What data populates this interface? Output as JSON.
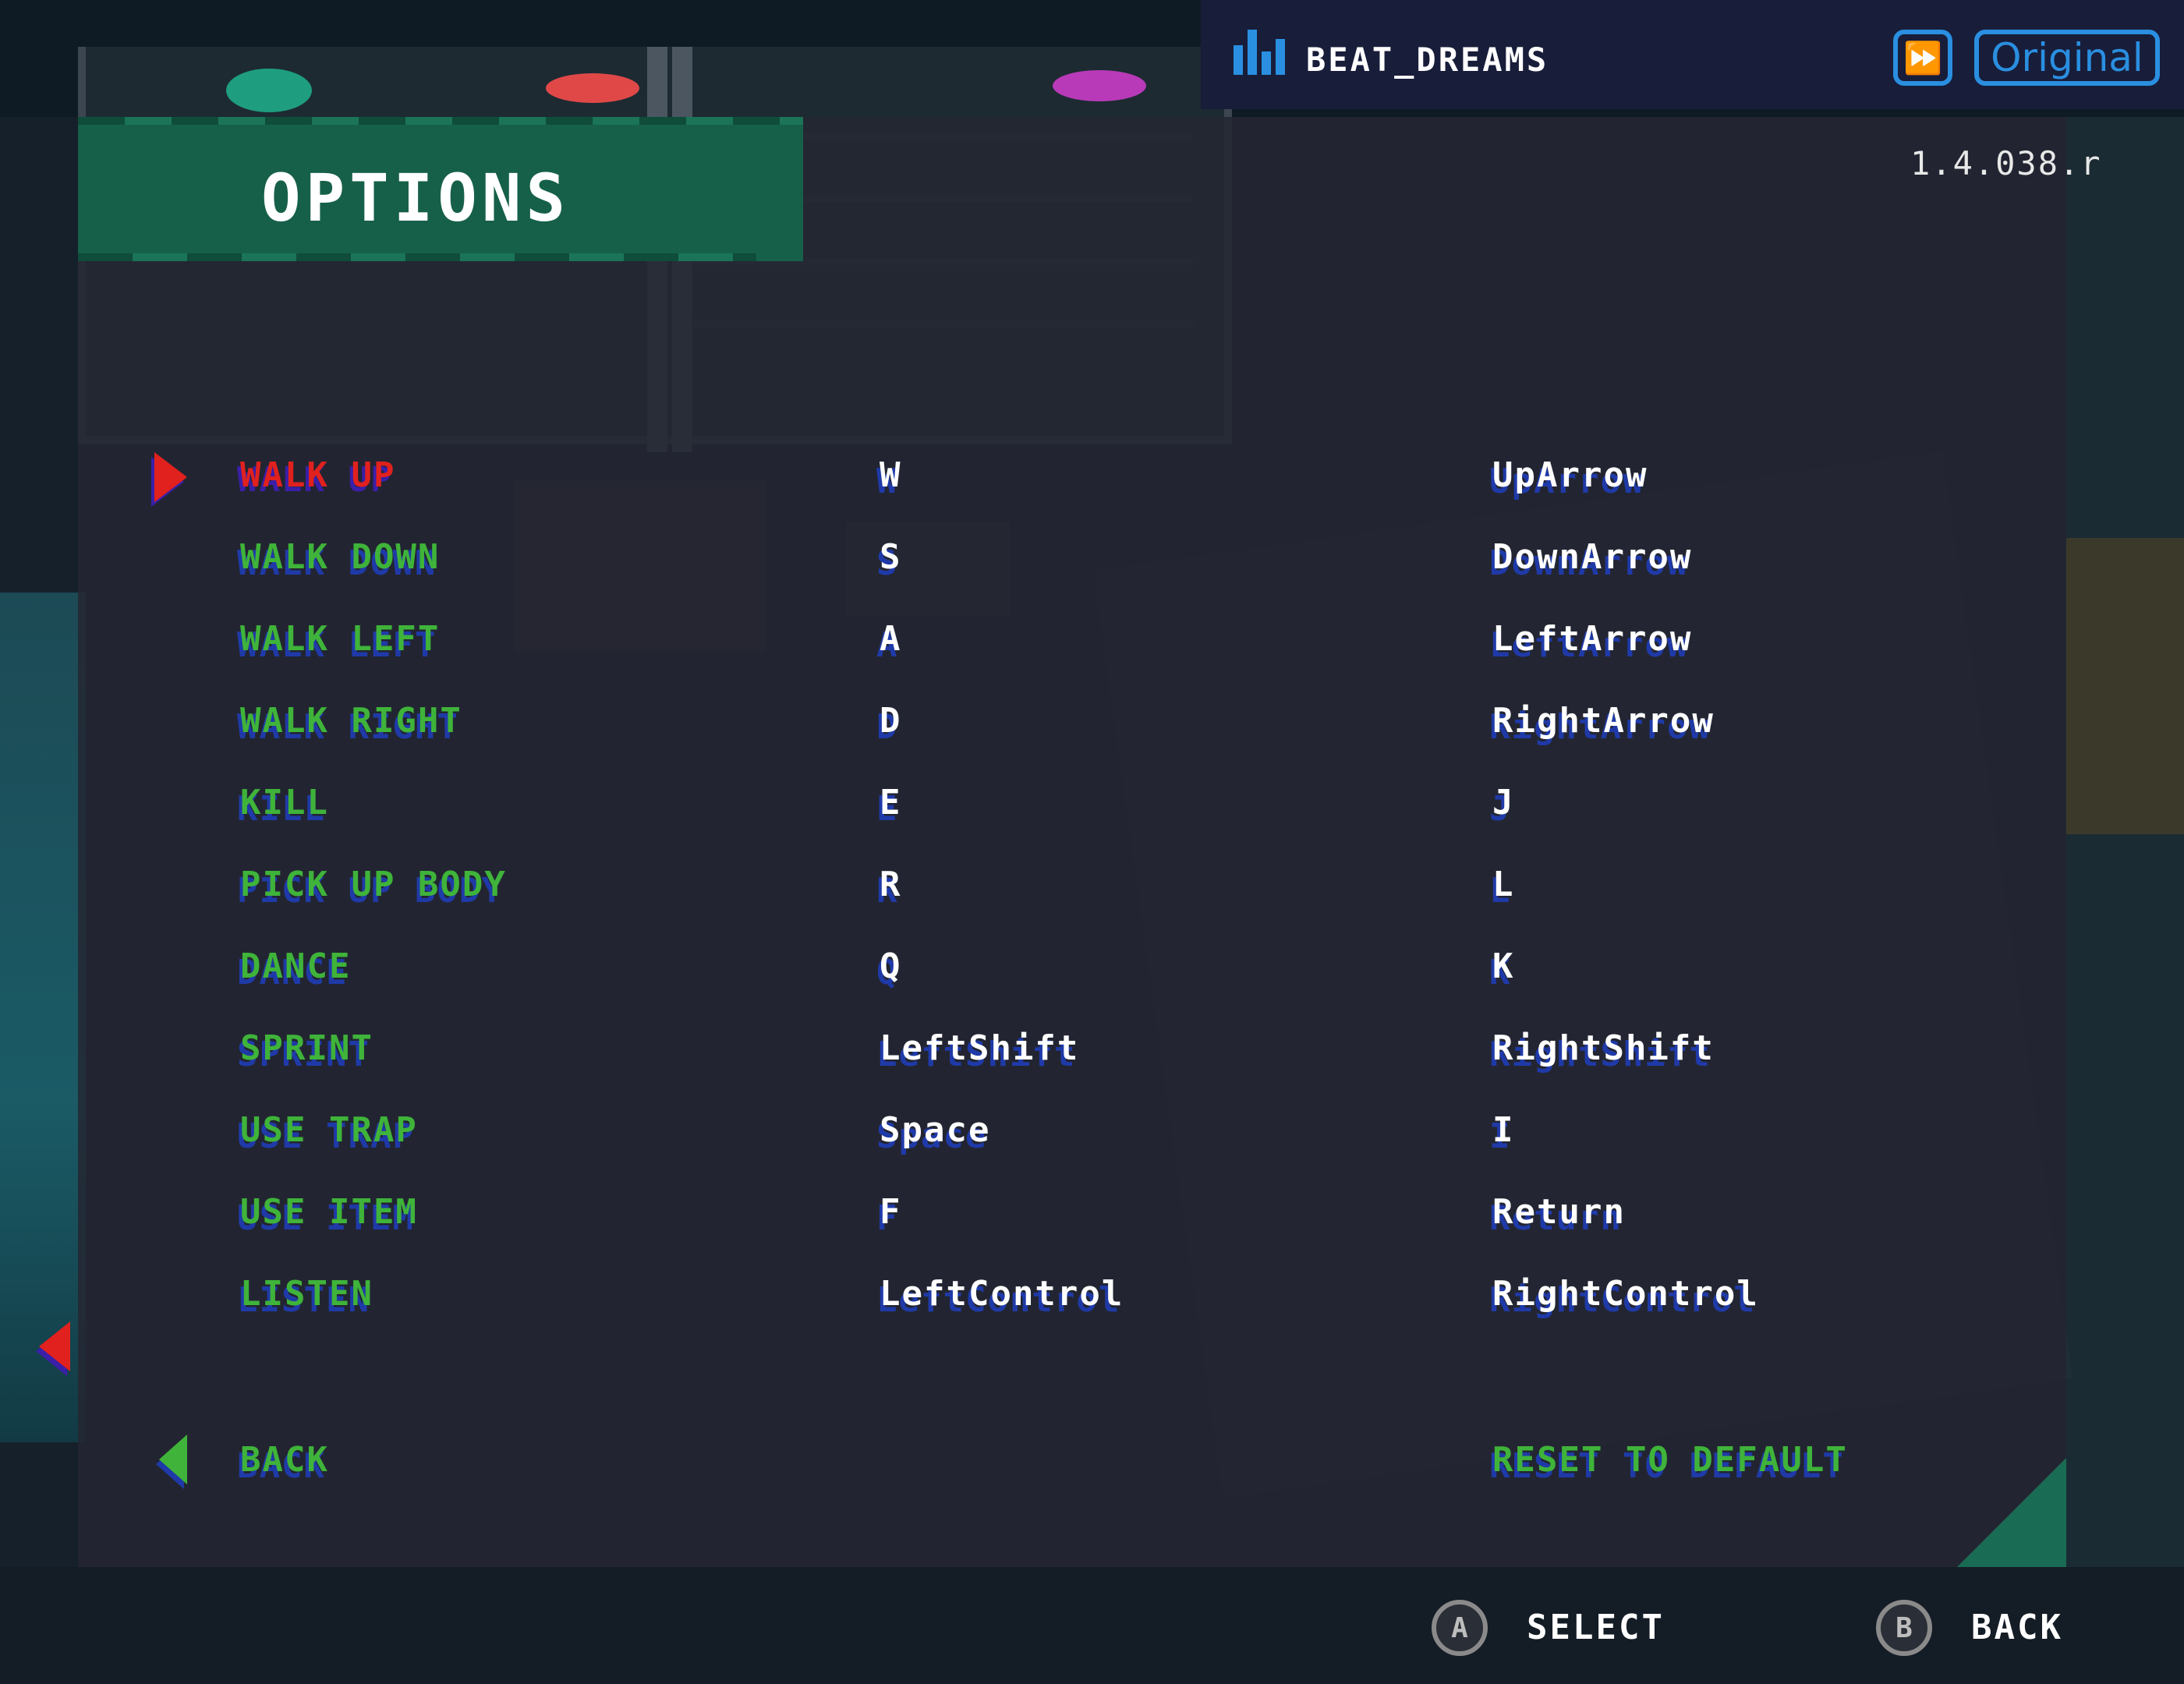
{
  "header": {
    "title": "OPTIONS",
    "version": "1.4.038.r"
  },
  "music": {
    "track": "BEAT_DREAMS",
    "ff_symbol": "⏩",
    "mode_label": "Original"
  },
  "bindings": [
    {
      "action": "WALK UP",
      "primary": "W",
      "secondary": "UpArrow"
    },
    {
      "action": "WALK DOWN",
      "primary": "S",
      "secondary": "DownArrow"
    },
    {
      "action": "WALK LEFT",
      "primary": "A",
      "secondary": "LeftArrow"
    },
    {
      "action": "WALK RIGHT",
      "primary": "D",
      "secondary": "RightArrow"
    },
    {
      "action": "KILL",
      "primary": "E",
      "secondary": "J"
    },
    {
      "action": "PICK UP BODY",
      "primary": "R",
      "secondary": "L"
    },
    {
      "action": "DANCE",
      "primary": "Q",
      "secondary": "K"
    },
    {
      "action": "SPRINT",
      "primary": "LeftShift",
      "secondary": "RightShift"
    },
    {
      "action": "USE TRAP",
      "primary": "Space",
      "secondary": "I"
    },
    {
      "action": "USE ITEM",
      "primary": "F",
      "secondary": "Return"
    },
    {
      "action": "LISTEN",
      "primary": "LeftControl",
      "secondary": "RightControl"
    }
  ],
  "footer_actions": {
    "back": "BACK",
    "reset": "RESET TO DEFAULT"
  },
  "prompts": [
    {
      "button": "A",
      "label": "SELECT"
    },
    {
      "button": "B",
      "label": "BACK"
    }
  ],
  "colors": {
    "selected": "#e0211e",
    "item": "#3fb33a",
    "shadow": "#1f3aa8",
    "banner": "#16604a",
    "accent": "#2a8fe0"
  }
}
